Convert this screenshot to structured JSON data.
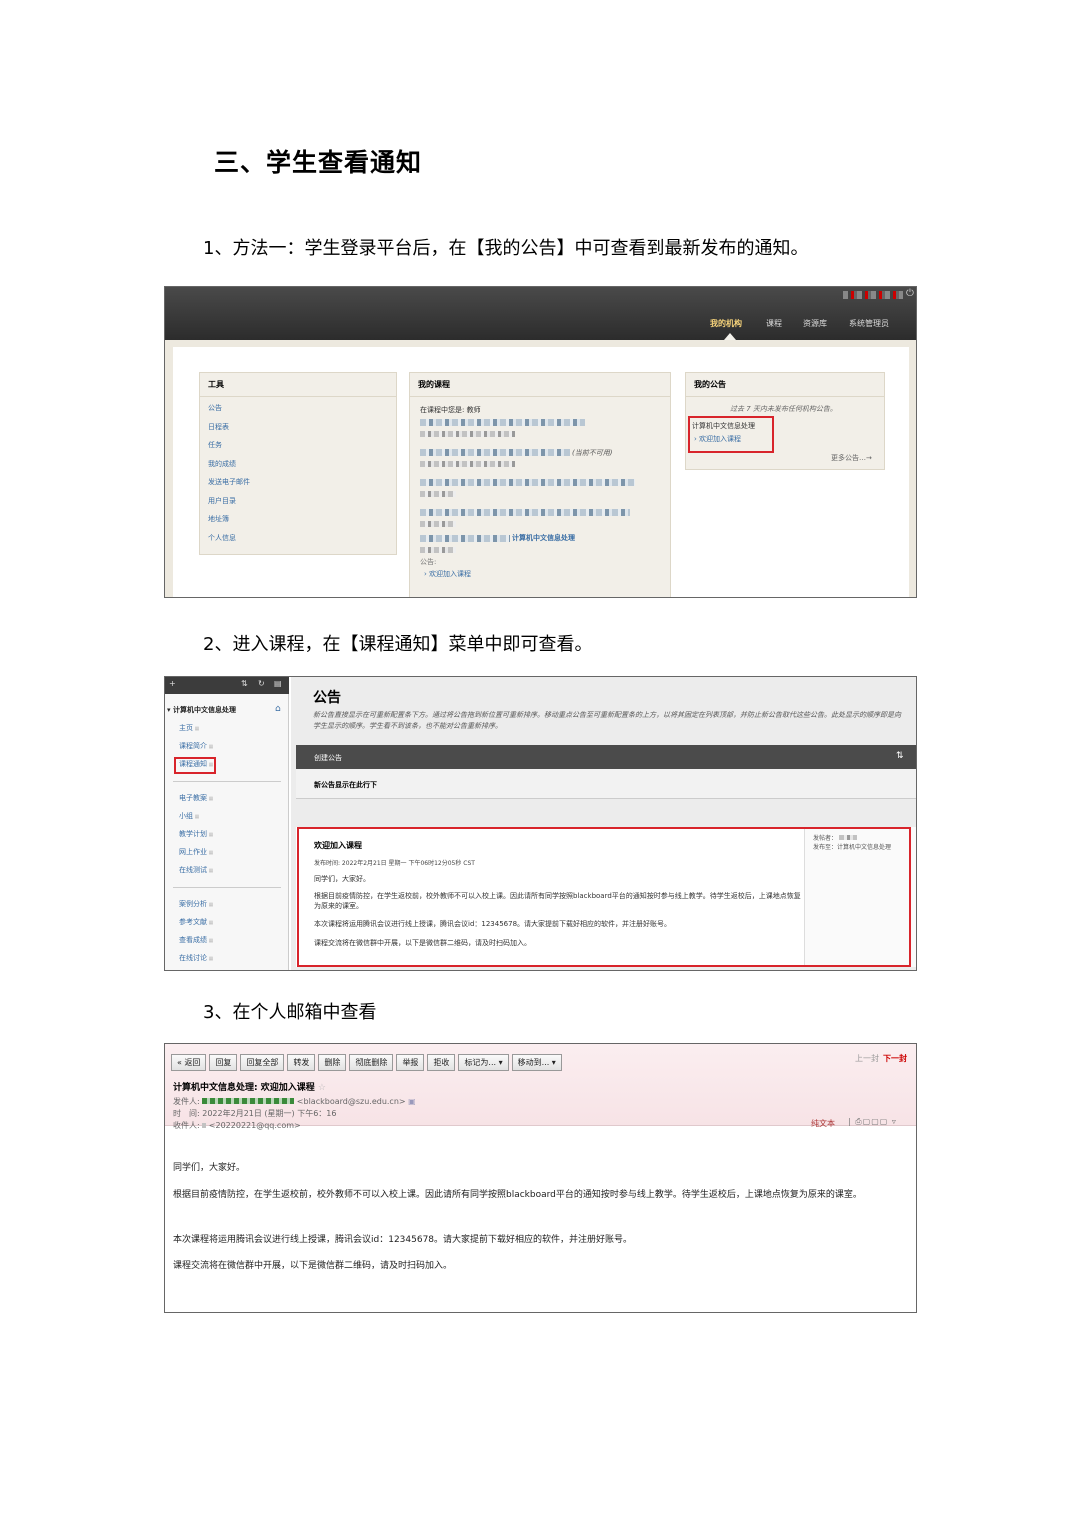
{
  "heading": "三、学生查看通知",
  "steps": [
    "1、方法一：学生登录平台后，在【我的公告】中可查看到最新发布的通知。",
    "2、进入课程，在【课程通知】菜单中即可查看。",
    "3、在个人邮箱中查看"
  ],
  "shot1": {
    "nav": [
      "我的机构",
      "课程",
      "资源库",
      "系统管理员"
    ],
    "tools_title": "工具",
    "tools": [
      "公告",
      "日程表",
      "任务",
      "我的成绩",
      "发送电子邮件",
      "用户目录",
      "地址簿",
      "个人信息"
    ],
    "courses_title": "我的课程",
    "courses_intro": "在课程中您是: 教师",
    "unavailable": "(当前不可用)",
    "course_name": "计算机中文信息处理",
    "ann_label": "公告:",
    "ann_item": "欢迎加入课程",
    "myann_title": "我的公告",
    "myann_note": "过去 7 天内未发布任何机构公告。",
    "myann_course": "计算机中文信息处理",
    "myann_item": "欢迎加入课程",
    "more": "更多公告…→"
  },
  "shot2": {
    "course": "计算机中文信息处理",
    "menu1": [
      "主页",
      "课程简介",
      "课程通知"
    ],
    "menu2": [
      "电子教案",
      "小组",
      "教学计划",
      "网上作业",
      "在线测试"
    ],
    "menu3": [
      "案例分析",
      "参考文献",
      "查看成绩",
      "在线讨论"
    ],
    "title": "公告",
    "desc": "新公告直接显示在可重新配置条下方。通过将公告拖到新位置可重新排序。移动重点公告至可重新配置条的上方，以将其固定在列表顶部，并防止新公告取代这些公告。此处显示的顺序即是向学生显示的顺序。学生看不到该条，也不能对公告重新排序。",
    "create": "创建公告",
    "newline": "新公告显示在此行下",
    "ann_title": "欢迎加入课程",
    "posted": "发布时间: 2022年2月21日 星期一 下午06时12分05秒 CST",
    "p1": "同学们，大家好。",
    "p2": "根据目前疫情防控，在学生返校前，校外教师不可以入校上课。因此请所有同学按照blackboard平台的通知按时参与线上教学。待学生返校后，上课地点恢复为原来的课室。",
    "p3": "本次课程将运用腾讯会议进行线上授课，腾讯会议id：12345678。请大家提前下载好相应的软件，并注册好账号。",
    "p4": "课程交流将在微信群中开展，以下是微信群二维码，请及时扫码加入。",
    "meta1": "发帖者：",
    "meta2": "发布至：计算机中文信息处理"
  },
  "shot3": {
    "buttons": [
      "« 返回",
      "回复",
      "回复全部",
      "转发",
      "删除",
      "彻底删除",
      "举报",
      "拒收",
      "标记为... ▾",
      "移动到... ▾"
    ],
    "prevnext_prev": "上一封",
    "prevnext_next": "下一封",
    "subject": "计算机中文信息处理: 欢迎加入课程",
    "from_label": "发件人:",
    "from_addr": "<blackboard@szu.edu.cn>",
    "time_label": "时　间:",
    "time": "2022年2月21日 (星期一) 下午6：16",
    "to_label": "收件人:",
    "to": "<20220221@qq.com>",
    "plain": "纯文本",
    "p1": "同学们，大家好。",
    "p2": "根据目前疫情防控，在学生返校前，校外教师不可以入校上课。因此请所有同学按照blackboard平台的通知按时参与线上教学。待学生返校后，上课地点恢复为原来的课室。",
    "p3": "本次课程将运用腾讯会议进行线上授课，腾讯会议id：12345678。请大家提前下载好相应的软件，并注册好账号。",
    "p4": "课程交流将在微信群中开展，以下是微信群二维码，请及时扫码加入。"
  }
}
